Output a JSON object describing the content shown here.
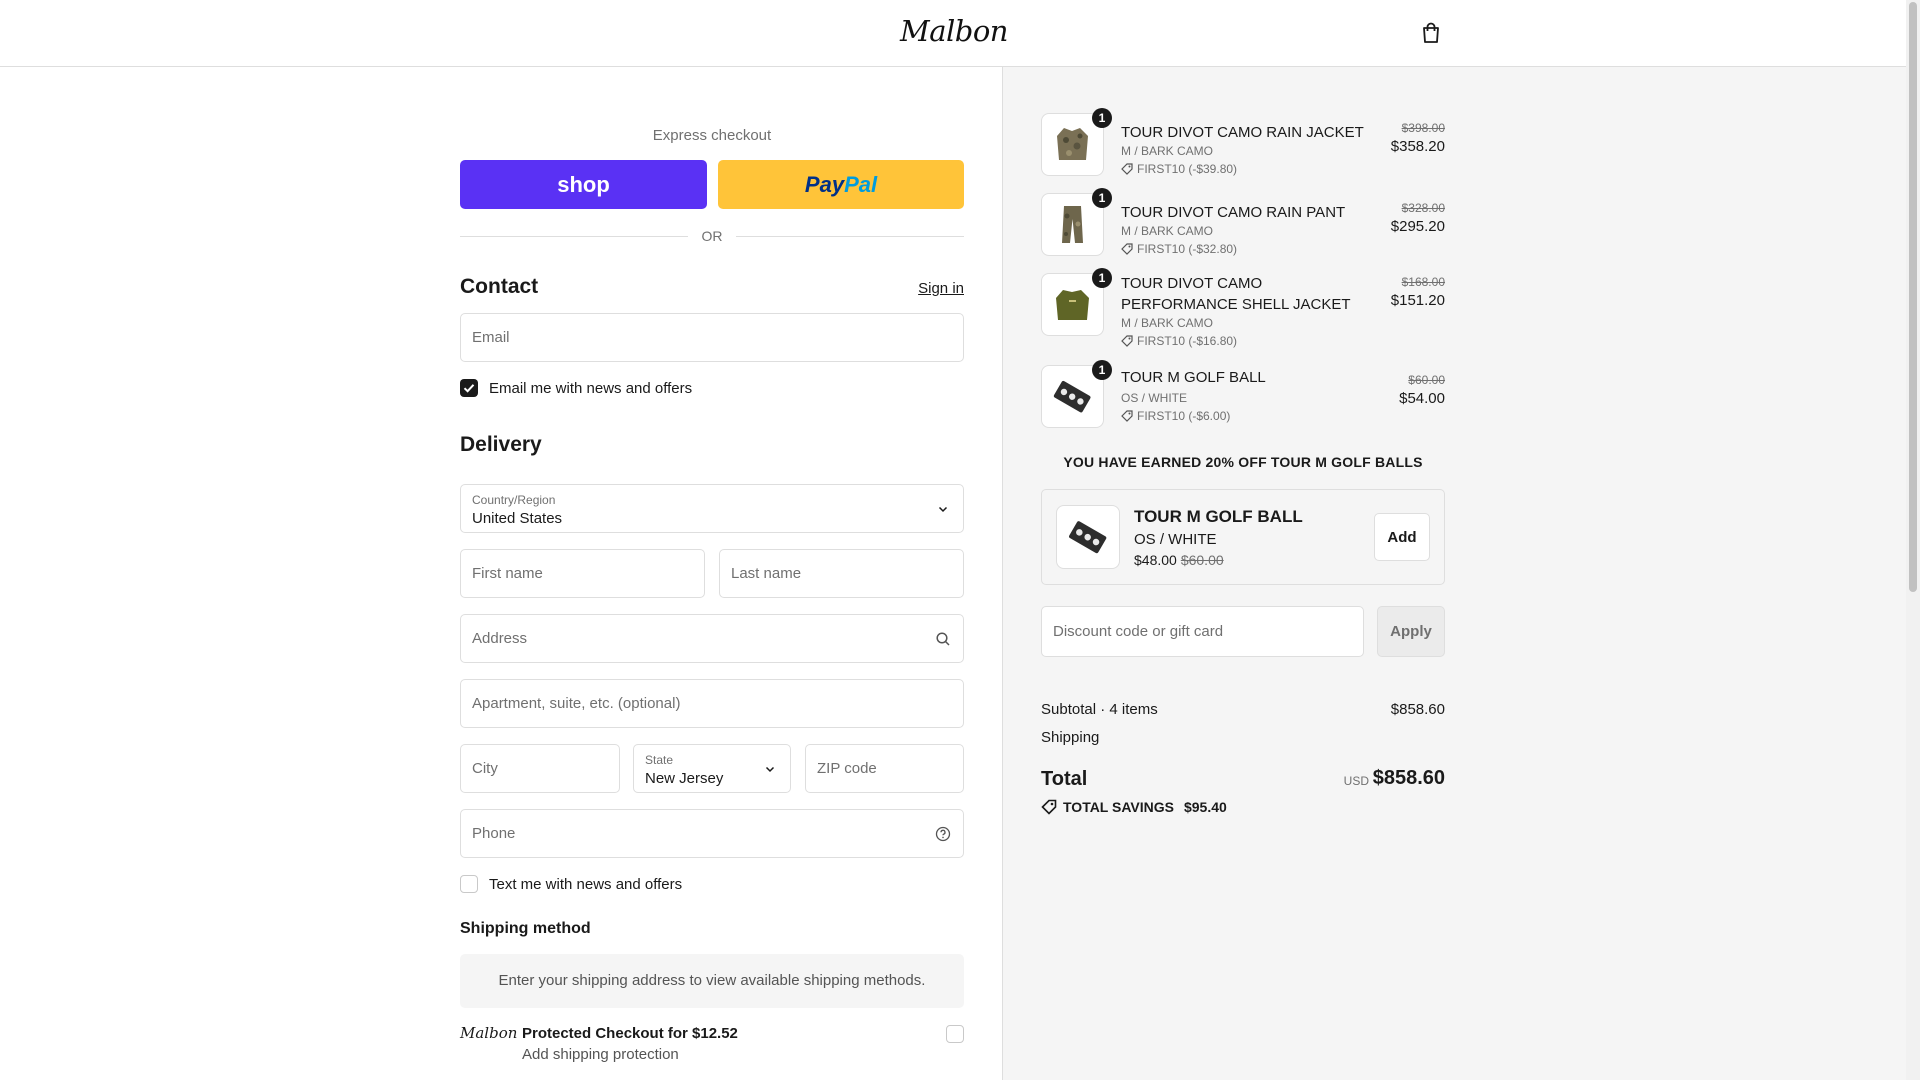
{
  "header": {
    "logo": "Malbon",
    "bag_icon": "shopping-bag-icon"
  },
  "express": {
    "title": "Express checkout",
    "shop_label": "shop",
    "paypal_part1": "Pay",
    "paypal_part2": "Pal",
    "or_label": "OR",
    "colors": {
      "shop": "#5a31f4",
      "paypal": "#ffc439"
    }
  },
  "contact": {
    "title": "Contact",
    "sign_in": "Sign in",
    "email_placeholder": "Email",
    "email_optin": "Email me with news and offers",
    "email_optin_checked": true
  },
  "delivery": {
    "title": "Delivery",
    "country_label": "Country/Region",
    "country_value": "United States",
    "first_name": "First name",
    "last_name": "Last name",
    "address": "Address",
    "apartment": "Apartment, suite, etc. (optional)",
    "city": "City",
    "state_label": "State",
    "state_value": "New Jersey",
    "zip": "ZIP code",
    "phone": "Phone",
    "sms_optin": "Text me with news and offers",
    "sms_optin_checked": false
  },
  "shipping": {
    "title": "Shipping method",
    "note": "Enter your shipping address to view available shipping methods.",
    "protect_logo": "Malbon",
    "protect_title": "Protected Checkout for $12.52",
    "protect_sub": "Add shipping protection"
  },
  "cart": {
    "items": [
      {
        "qty": "1",
        "name": "TOUR DIVOT CAMO RAIN JACKET",
        "variant": "M / BARK CAMO",
        "discount": "FIRST10 (-$39.80)",
        "old_price": "$398.00",
        "price": "$358.20"
      },
      {
        "qty": "1",
        "name": "TOUR DIVOT CAMO RAIN PANT",
        "variant": "M / BARK CAMO",
        "discount": "FIRST10 (-$32.80)",
        "old_price": "$328.00",
        "price": "$295.20"
      },
      {
        "qty": "1",
        "name": "TOUR DIVOT CAMO PERFORMANCE SHELL JACKET",
        "variant": "M / BARK CAMO",
        "discount": "FIRST10 (-$16.80)",
        "old_price": "$168.00",
        "price": "$151.20"
      },
      {
        "qty": "1",
        "name": "TOUR M GOLF BALL",
        "variant": "OS / WHITE",
        "discount": "FIRST10 (-$6.00)",
        "old_price": "$60.00",
        "price": "$54.00"
      }
    ],
    "earned": "YOU HAVE EARNED 20% OFF TOUR M GOLF BALLS",
    "upsell": {
      "name": "TOUR M GOLF BALL",
      "variant": "OS / WHITE",
      "price": "$48.00",
      "old_price": "$60.00",
      "add": "Add"
    },
    "discount_placeholder": "Discount code or gift card",
    "apply": "Apply",
    "subtotal_label": "Subtotal · 4 items",
    "subtotal_value": "$858.60",
    "shipping_label": "Shipping",
    "total_label": "Total",
    "currency": "USD",
    "total_value": "$858.60",
    "savings_label": "TOTAL SAVINGS",
    "savings_value": "$95.40"
  }
}
